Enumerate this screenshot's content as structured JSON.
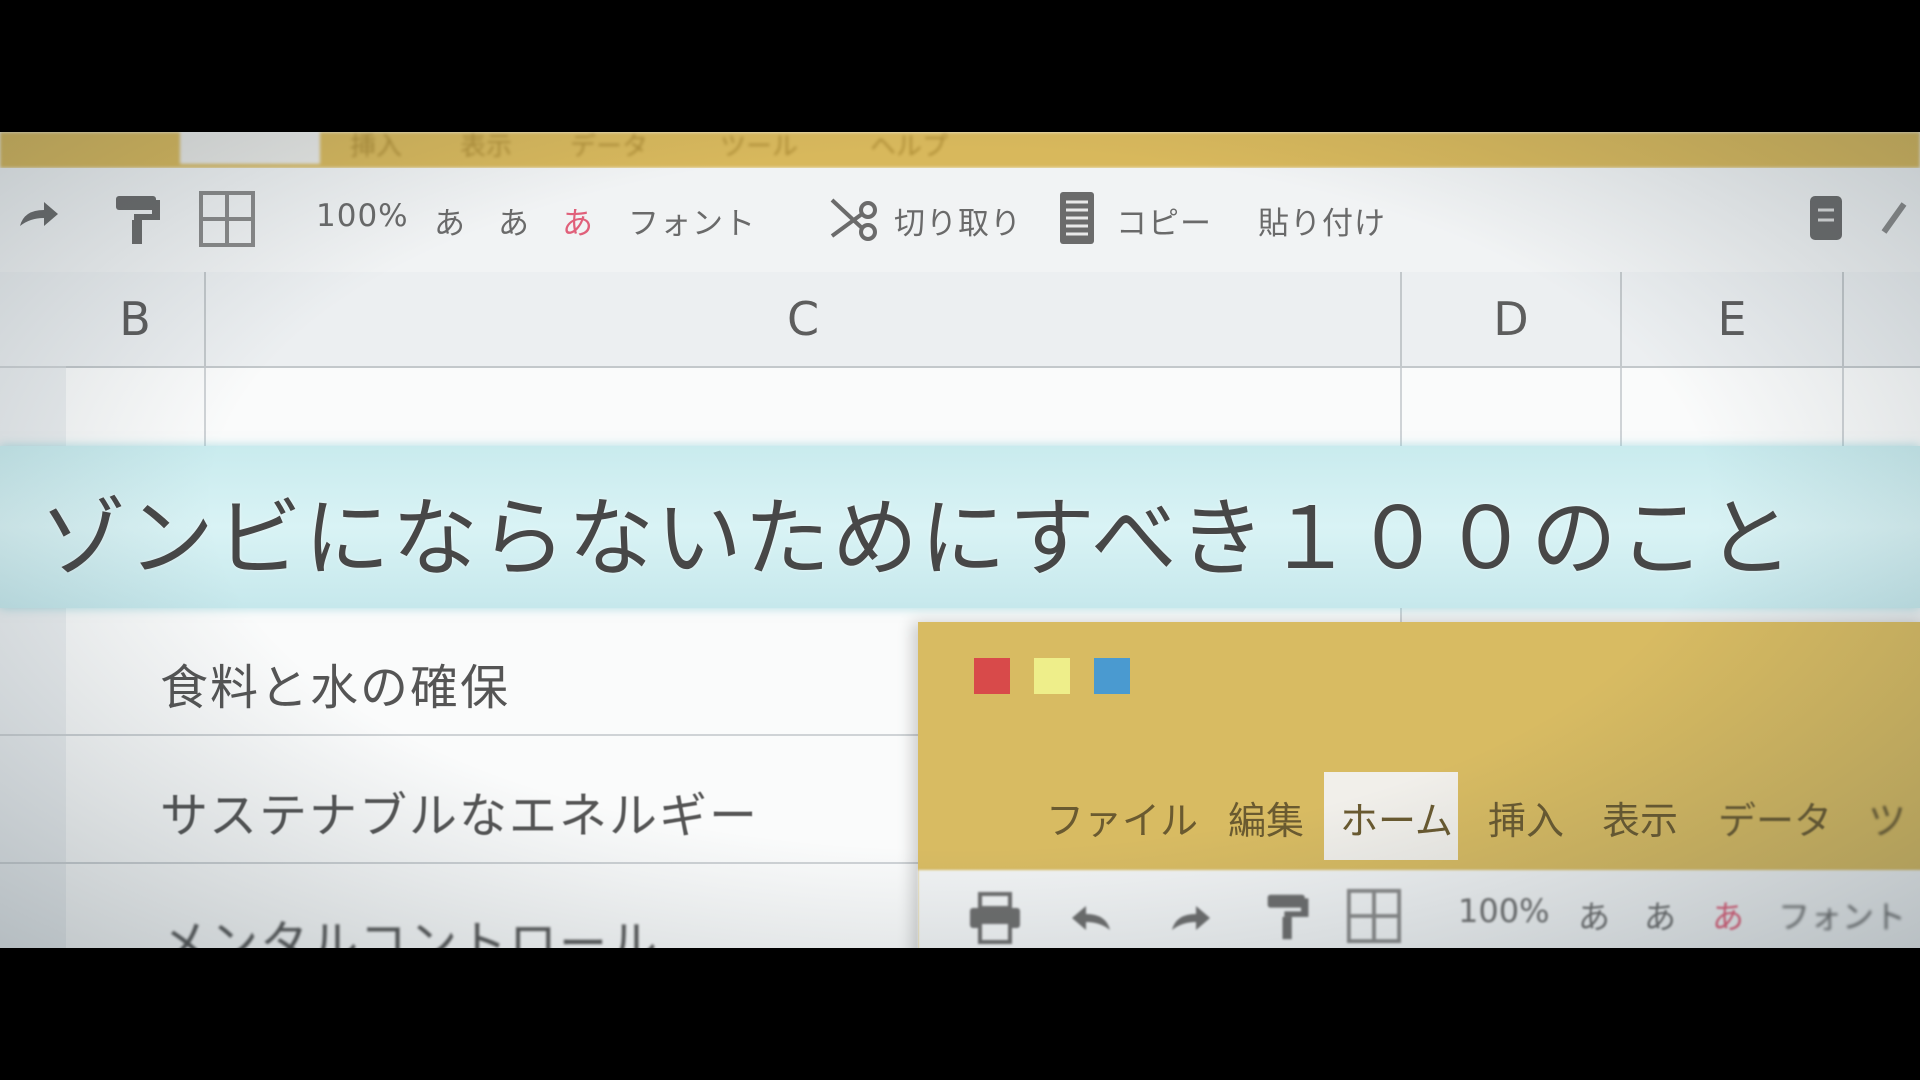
{
  "ribbon_top": {
    "ghost_items": [
      "挿入",
      "表示",
      "データ",
      "ツール",
      "ヘルプ"
    ]
  },
  "toolbar": {
    "zoom": "100%",
    "font_a1": "あ",
    "font_a2": "あ",
    "font_a3": "あ",
    "font_label": "フォント",
    "cut_label": "切り取り",
    "copy_label": "コピー",
    "paste_label": "貼り付け",
    "accent_color": "#e0607a"
  },
  "columns": [
    "B",
    "C",
    "D",
    "E"
  ],
  "banner": {
    "title": "ゾンビにならないためにすべき１００のこと"
  },
  "list": [
    "食料と水の確保",
    "サステナブルなエネルギー",
    "メンタルコントロール"
  ],
  "window": {
    "dots": [
      "#d84a4a",
      "#eeee8a",
      "#4a9ad0"
    ],
    "menu": [
      "ファイル",
      "編集",
      "ホーム",
      "挿入",
      "表示",
      "データ",
      "ツ"
    ],
    "active_menu": "ホーム",
    "toolbar": {
      "zoom": "100%",
      "a1": "あ",
      "a2": "あ",
      "a3": "あ",
      "font_label": "フォント"
    }
  }
}
